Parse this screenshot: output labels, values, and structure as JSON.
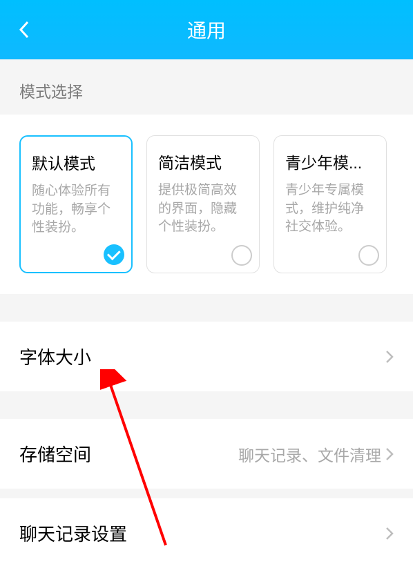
{
  "header": {
    "title": "通用"
  },
  "section": {
    "label": "模式选择"
  },
  "modes": [
    {
      "title": "默认模式",
      "desc": "随心体验所有功能，畅享个性装扮。",
      "selected": true
    },
    {
      "title": "简洁模式",
      "desc": "提供极简高效的界面，隐藏个性装扮。",
      "selected": false
    },
    {
      "title": "青少年模...",
      "desc": "青少年专属模式，维护纯净社交体验。",
      "selected": false
    }
  ],
  "list": {
    "fontSize": "字体大小",
    "storage": "存储空间",
    "storageSub": "聊天记录、文件清理",
    "chatRecord": "聊天记录设置"
  }
}
